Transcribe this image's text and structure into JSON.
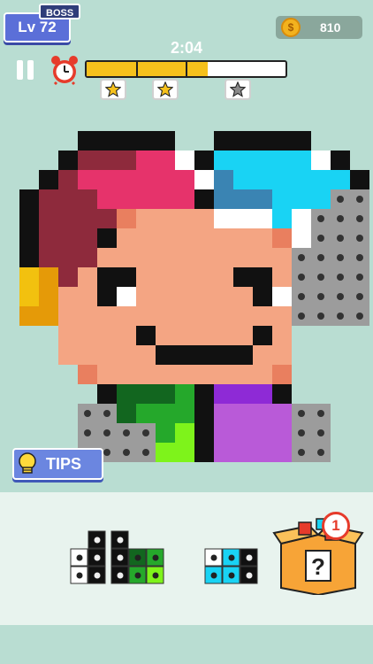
{
  "header": {
    "level_label": "Lv 72",
    "boss_tag": "BOSS",
    "coins": "810",
    "coin_symbol": "$"
  },
  "timer": {
    "time": "2:04",
    "progress": 0.61,
    "stars": [
      {
        "earned": true
      },
      {
        "earned": true
      },
      {
        "earned": false
      }
    ]
  },
  "tips": {
    "label": "TIPS"
  },
  "mystery": {
    "badge_count": "1",
    "symbol": "?"
  },
  "colors": {
    "background": "#b9ddd2",
    "tray": "#e8f3ee",
    "accent_blue": "#5b6fd8",
    "progress_fill": "#f6c11c",
    "star_gold": "#f6c11c",
    "star_grey": "#8a8a8a"
  },
  "pixel_art": {
    "palette": {
      ".": null,
      "K": "#111111",
      "W": "#ffffff",
      "m": "#8e2a3c",
      "p": "#e6336b",
      "b": "#19d3f4",
      "d": "#3a84b3",
      "s": "#f4a583",
      "o": "#e97f5f",
      "y": "#f2c10f",
      "Y": "#e59a08",
      "g": "#12661f",
      "l": "#7ef31b",
      "L": "#25a82b",
      "v": "#8e2ad6",
      "V": "#b95ad8",
      "G": "#9c9c9c"
    },
    "rows": [
      "...KKKKK..KKKKK...",
      "..KmmmppWKbbbbbWK.",
      ".KmppppppWdbbbbbbK",
      "KmmmpppppKdddbbbGG",
      "KmmmmossssWWWbWGGG",
      "KmmmKssssssssoWGGG",
      "KmmmssssssssssGGGG",
      "yYmsKKsssssKKsGGGG",
      "yYssKWssssssKWGGGG",
      "YYssssssssssssGGGG",
      "..ssssKsssssKs....",
      "..sssssKKKKKss....",
      "...ossssssssso....",
      "....KgggLKvvvK....",
      "...GGgLLLKVVVVGG..",
      "...GGGGLlKVVVVGG..",
      "...GGGGllKVVVVGG.."
    ]
  },
  "tray_pieces": [
    {
      "cells": [
        "..K",
        ".WK",
        ".WK"
      ]
    },
    {
      "cells": [
        "K..",
        "KgL",
        "KLl"
      ]
    },
    {
      "cells": [
        "WbK",
        "bbK"
      ]
    }
  ]
}
